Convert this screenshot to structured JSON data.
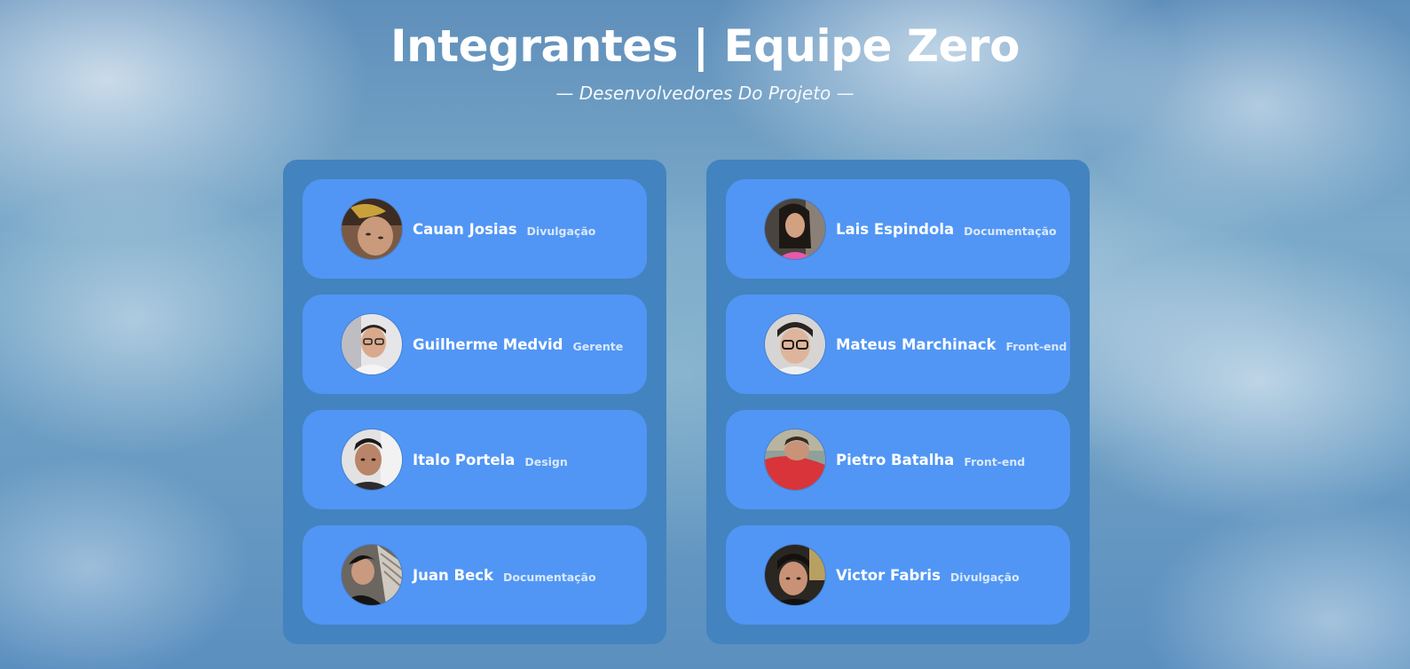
{
  "header": {
    "title": "Integrantes | Equipe Zero",
    "subtitle": "— Desenvolvedores Do Projeto —"
  },
  "colors": {
    "column_bg": "#4383bf",
    "card_bg": "#5196f5",
    "text": "#ffffff"
  },
  "left_column": {
    "members": [
      {
        "name": "Cauan Josias",
        "role": "Divulgação"
      },
      {
        "name": "Guilherme Medvid",
        "role": "Gerente"
      },
      {
        "name": "Italo Portela",
        "role": "Design"
      },
      {
        "name": "Juan Beck",
        "role": "Documentação"
      }
    ]
  },
  "right_column": {
    "members": [
      {
        "name": "Lais Espindola",
        "role": "Documentação"
      },
      {
        "name": "Mateus Marchinack",
        "role": "Front-end"
      },
      {
        "name": "Pietro Batalha",
        "role": "Front-end"
      },
      {
        "name": "Victor Fabris",
        "role": "Divulgação"
      }
    ]
  }
}
